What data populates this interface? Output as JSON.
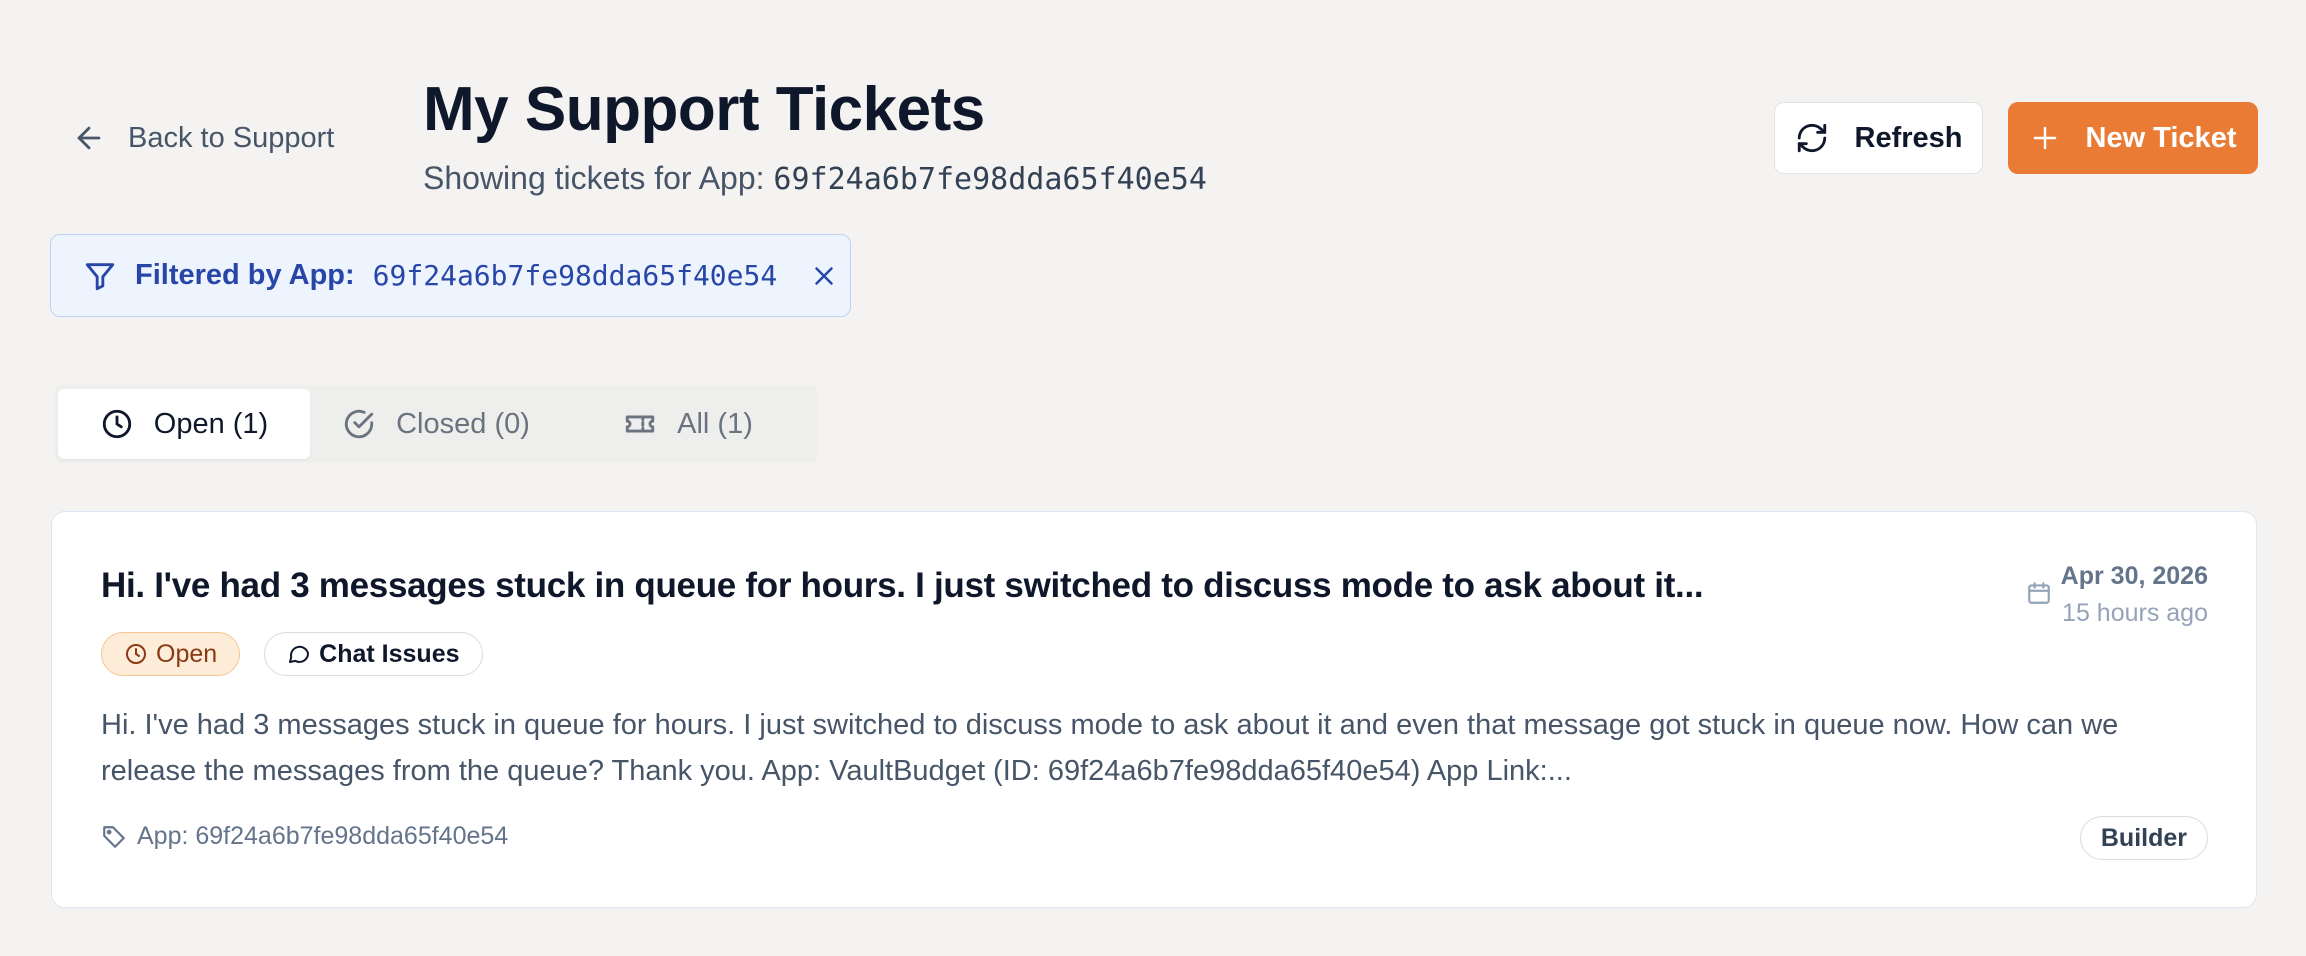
{
  "header": {
    "back_label": "Back to Support",
    "title": "My Support Tickets",
    "subtitle_prefix": "Showing tickets for App:",
    "app_id": "69f24a6b7fe98dda65f40e54",
    "refresh_label": "Refresh",
    "new_ticket_label": "New Ticket"
  },
  "filter": {
    "label": "Filtered by App:",
    "value": "69f24a6b7fe98dda65f40e54"
  },
  "tabs": [
    {
      "label": "Open (1)",
      "icon": "clock-icon",
      "active": true
    },
    {
      "label": "Closed (0)",
      "icon": "check-circle-icon",
      "active": false
    },
    {
      "label": "All (1)",
      "icon": "ticket-icon",
      "active": false
    }
  ],
  "tickets": [
    {
      "title": "Hi. I've had 3 messages stuck in queue for hours. I just switched to discuss mode to ask about it...",
      "date": "Apr 30, 2026",
      "relative_time": "15 hours ago",
      "status": "Open",
      "category": "Chat Issues",
      "description": "Hi. I've had 3 messages stuck in queue for hours. I just switched to discuss mode to ask about it and even that message got stuck in queue now. How can we release the messages from the queue? Thank you. App: VaultBudget (ID: 69f24a6b7fe98dda65f40e54) App Link:...",
      "app_label": "App: 69f24a6b7fe98dda65f40e54",
      "source": "Builder"
    }
  ],
  "colors": {
    "accent": "#ea7b35",
    "filter_text": "#2846a8",
    "status_open_bg": "#fdecd7"
  }
}
